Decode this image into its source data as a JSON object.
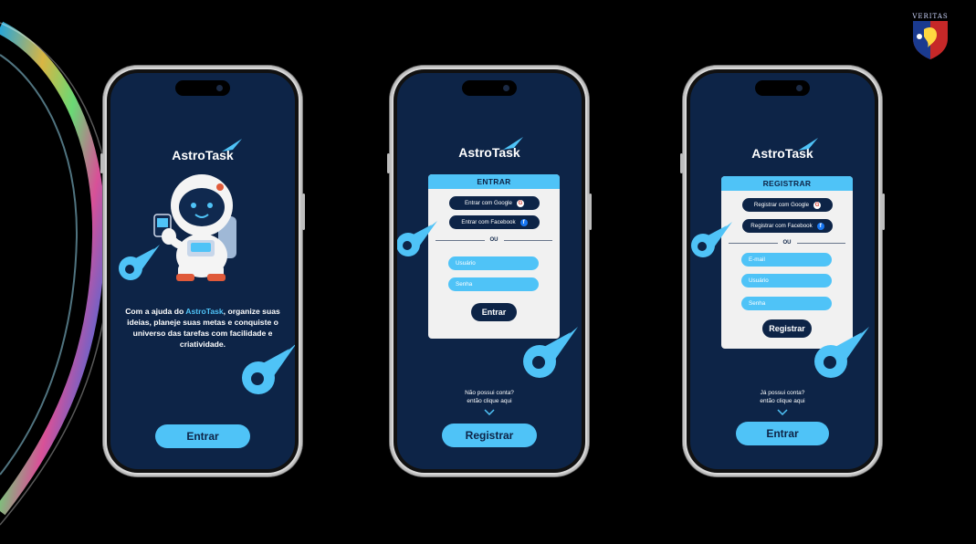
{
  "brand": {
    "name_part1": "Astro",
    "name_part2": "Task"
  },
  "crest": {
    "label": "VERITAS"
  },
  "screen_welcome": {
    "intro_prefix": "Com a ajuda do ",
    "intro_highlight": "AstroTask",
    "intro_suffix": ", organize suas ideias, planeje suas metas e conquiste o universo das tarefas com facilidade e criatividade.",
    "enter_button": "Entrar"
  },
  "screen_login": {
    "title": "ENTRAR",
    "google_button": "Entrar com Google",
    "facebook_button": "Entrar com Facebook",
    "divider": "OU",
    "username_placeholder": "Usuário",
    "password_placeholder": "Senha",
    "submit_button": "Entrar",
    "hint_line1": "Não possui conta?",
    "hint_line2": "então clique aqui",
    "register_button": "Registrar"
  },
  "screen_register": {
    "title": "REGISTRAR",
    "google_button": "Registrar com Google",
    "facebook_button": "Registrar com Facebook",
    "divider": "OU",
    "email_placeholder": "E-mail",
    "username_placeholder": "Usuário",
    "password_placeholder": "Senha",
    "submit_button": "Registrar",
    "hint_line1": "Já possui conta?",
    "hint_line2": "então clique aqui",
    "enter_button": "Entrar"
  },
  "colors": {
    "screen_bg": "#0d2447",
    "accent": "#4fc3f7",
    "card_bg": "#f1f1f1"
  },
  "icons": [
    "comet-icon",
    "google-icon",
    "facebook-icon",
    "chevron-down-icon",
    "astronaut-illustration",
    "veritas-crest"
  ]
}
